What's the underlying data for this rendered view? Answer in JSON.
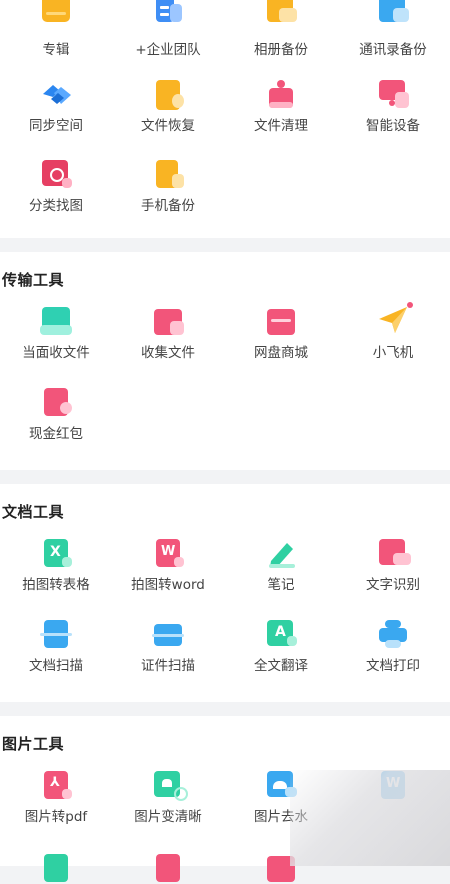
{
  "backup_items": [
    {
      "label": "专辑",
      "icon": "album-icon",
      "color": "#f9b423"
    },
    {
      "label": "+企业团队",
      "icon": "enterprise-team-icon",
      "color": "#3f8ef5"
    },
    {
      "label": "相册备份",
      "icon": "album-backup-icon",
      "color": "#f9b423"
    },
    {
      "label": "通讯录备份",
      "icon": "contacts-backup-icon",
      "color": "#3aa8f0"
    },
    {
      "label": "同步空间",
      "icon": "sync-space-icon",
      "color": "#2b86f0"
    },
    {
      "label": "文件恢复",
      "icon": "file-restore-icon",
      "color": "#f9b423"
    },
    {
      "label": "文件清理",
      "icon": "file-cleanup-icon",
      "color": "#f2557a"
    },
    {
      "label": "智能设备",
      "icon": "smart-device-icon",
      "color": "#f2557a"
    },
    {
      "label": "分类找图",
      "icon": "category-image-search-icon",
      "color": "#e63f63"
    },
    {
      "label": "手机备份",
      "icon": "phone-backup-icon",
      "color": "#f9b423"
    }
  ],
  "transfer": {
    "title": "传输工具",
    "items": [
      {
        "label": "当面收文件",
        "icon": "face-to-face-receive-icon",
        "color": "#2fd0b2"
      },
      {
        "label": "收集文件",
        "icon": "collect-files-icon",
        "color": "#f2557a"
      },
      {
        "label": "网盘商城",
        "icon": "cloud-mall-icon",
        "color": "#f2557a"
      },
      {
        "label": "小飞机",
        "icon": "paper-plane-icon",
        "color": "#f9b423"
      },
      {
        "label": "现金红包",
        "icon": "cash-red-packet-icon",
        "color": "#f2557a"
      }
    ]
  },
  "document": {
    "title": "文档工具",
    "items": [
      {
        "label": "拍图转表格",
        "icon": "photo-to-spreadsheet-icon",
        "color": "#2fd0a2"
      },
      {
        "label": "拍图转word",
        "icon": "photo-to-word-icon",
        "color": "#f2557a"
      },
      {
        "label": "笔记",
        "icon": "note-pen-icon",
        "color": "#2fd0a2"
      },
      {
        "label": "文字识别",
        "icon": "text-recognition-icon",
        "color": "#f2557a"
      },
      {
        "label": "文档扫描",
        "icon": "document-scan-icon",
        "color": "#3aa8f0"
      },
      {
        "label": "证件扫描",
        "icon": "id-scan-icon",
        "color": "#3aa8f0"
      },
      {
        "label": "全文翻译",
        "icon": "full-text-translate-icon",
        "color": "#2fd0a2"
      },
      {
        "label": "文档打印",
        "icon": "document-print-icon",
        "color": "#3aa8f0"
      }
    ]
  },
  "image": {
    "title": "图片工具",
    "items": [
      {
        "label": "图片转pdf",
        "icon": "image-to-pdf-icon",
        "color": "#f2557a"
      },
      {
        "label": "图片变清晰",
        "icon": "image-enhance-icon",
        "color": "#2fd0a2"
      },
      {
        "label": "图片去水",
        "icon": "image-watermark-remove-icon",
        "color": "#3aa8f0"
      },
      {
        "label": "",
        "icon": "image-to-word-icon",
        "color": "#3aa8f0"
      }
    ]
  }
}
